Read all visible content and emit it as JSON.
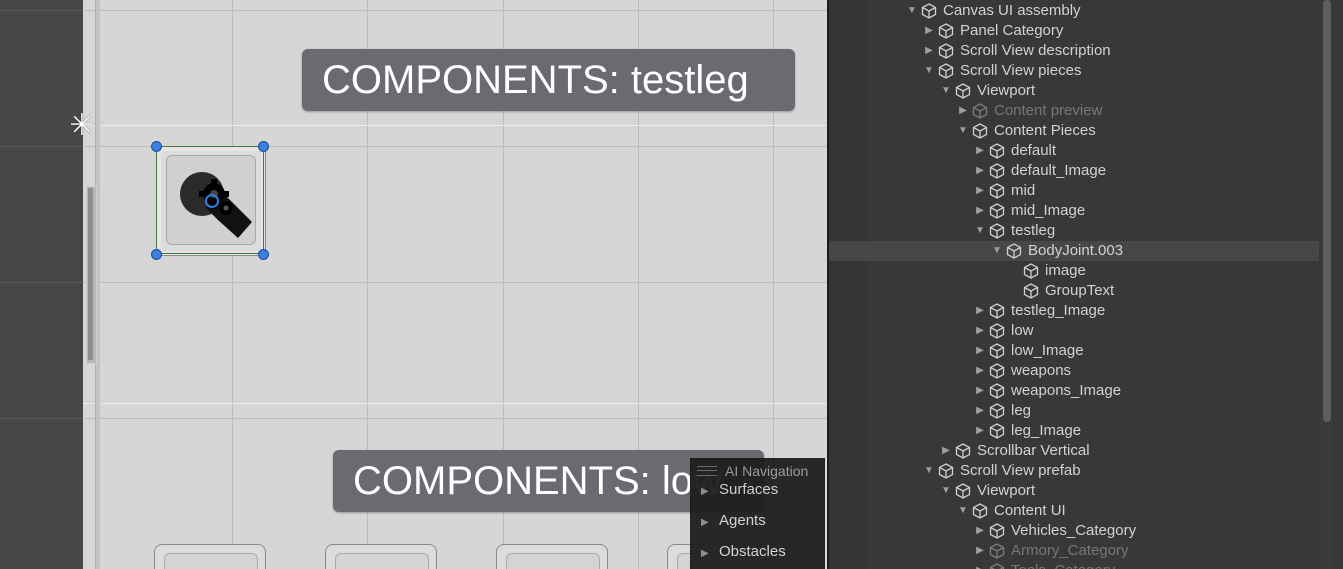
{
  "scene": {
    "title_top": "COMPONENTS: testleg",
    "title_bottom": "COMPONENTS: low"
  },
  "overlay": {
    "title": "AI Navigation",
    "items": [
      "Surfaces",
      "Agents",
      "Obstacles"
    ]
  },
  "hierarchy": {
    "rows": [
      {
        "label": "Canvas UI assembly",
        "depth": 0,
        "expanded": true
      },
      {
        "label": "Panel Category",
        "depth": 1,
        "expanded": false
      },
      {
        "label": "Scroll View description",
        "depth": 1,
        "expanded": false
      },
      {
        "label": "Scroll View pieces",
        "depth": 1,
        "expanded": true
      },
      {
        "label": "Viewport",
        "depth": 2,
        "expanded": true
      },
      {
        "label": "Content preview",
        "depth": 3,
        "expanded": false,
        "dim": true
      },
      {
        "label": "Content Pieces",
        "depth": 3,
        "expanded": true
      },
      {
        "label": "default",
        "depth": 4,
        "expanded": false
      },
      {
        "label": "default_Image",
        "depth": 4,
        "expanded": false
      },
      {
        "label": "mid",
        "depth": 4,
        "expanded": false
      },
      {
        "label": "mid_Image",
        "depth": 4,
        "expanded": false
      },
      {
        "label": "testleg",
        "depth": 4,
        "expanded": true
      },
      {
        "label": "BodyJoint.003",
        "depth": 5,
        "expanded": true,
        "selected": true
      },
      {
        "label": "image",
        "depth": 6,
        "leaf": true
      },
      {
        "label": "GroupText",
        "depth": 6,
        "leaf": true
      },
      {
        "label": "testleg_Image",
        "depth": 4,
        "expanded": false
      },
      {
        "label": "low",
        "depth": 4,
        "expanded": false
      },
      {
        "label": "low_Image",
        "depth": 4,
        "expanded": false
      },
      {
        "label": "weapons",
        "depth": 4,
        "expanded": false
      },
      {
        "label": "weapons_Image",
        "depth": 4,
        "expanded": false
      },
      {
        "label": "leg",
        "depth": 4,
        "expanded": false
      },
      {
        "label": "leg_Image",
        "depth": 4,
        "expanded": false
      },
      {
        "label": "Scrollbar Vertical",
        "depth": 2,
        "expanded": false
      },
      {
        "label": "Scroll View prefab",
        "depth": 1,
        "expanded": true
      },
      {
        "label": "Viewport",
        "depth": 2,
        "expanded": true
      },
      {
        "label": "Content UI",
        "depth": 3,
        "expanded": true
      },
      {
        "label": "Vehicles_Category",
        "depth": 4,
        "expanded": false
      },
      {
        "label": "Armory_Category",
        "depth": 4,
        "expanded": false,
        "dim": true
      },
      {
        "label": "Tools_Category",
        "depth": 4,
        "expanded": false,
        "dim": true
      }
    ]
  },
  "icons": {
    "object": "cube-icon",
    "component": "gear-puzzle-icon",
    "pivot": "pivot-star-icon"
  },
  "colors": {
    "scene_bg": "#d6d6d6",
    "title_bg": "#6a6b70",
    "hierarchy_bg": "#383838",
    "selection": "#474747",
    "handle": "#3b7fe0"
  }
}
